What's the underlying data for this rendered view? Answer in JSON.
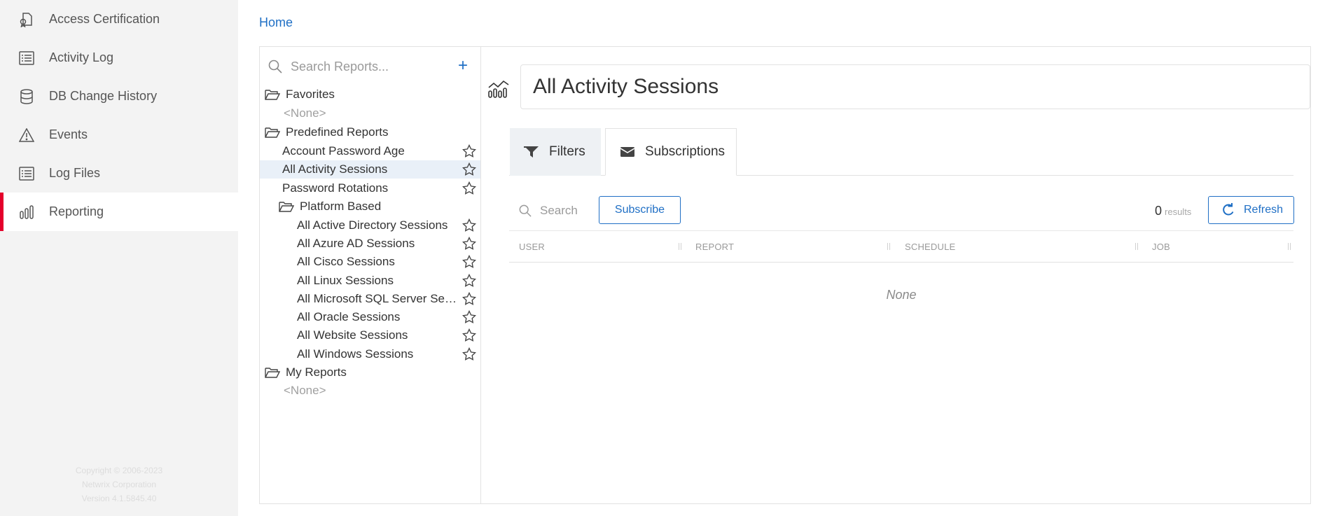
{
  "nav": {
    "items": [
      {
        "label": "Access Certification",
        "icon": "certificate-icon",
        "active": false
      },
      {
        "label": "Activity Log",
        "icon": "list-icon",
        "active": false
      },
      {
        "label": "DB Change History",
        "icon": "database-icon",
        "active": false
      },
      {
        "label": "Events",
        "icon": "warning-icon",
        "active": false
      },
      {
        "label": "Log Files",
        "icon": "list-icon",
        "active": false
      },
      {
        "label": "Reporting",
        "icon": "bar-chart-icon",
        "active": true
      }
    ],
    "accent_color": "#e4002b",
    "copyright_lines": [
      "Copyright © 2006-2023",
      "Netwrix Corporation",
      "Version 4.1.5845.40"
    ]
  },
  "breadcrumb": {
    "home": "Home"
  },
  "tree": {
    "search_placeholder": "Search Reports...",
    "add_label": "+",
    "favorites": {
      "label": "Favorites",
      "empty": "<None>"
    },
    "predefined": {
      "label": "Predefined Reports",
      "items": [
        "Account Password Age",
        "All Activity Sessions",
        "Password Rotations"
      ],
      "selected": "All Activity Sessions"
    },
    "platform": {
      "label": "Platform Based",
      "items": [
        "All Active Directory Sessions",
        "All Azure AD Sessions",
        "All Cisco Sessions",
        "All Linux Sessions",
        "All Microsoft SQL Server Ses...",
        "All Oracle Sessions",
        "All Website Sessions",
        "All Windows Sessions"
      ]
    },
    "my_reports": {
      "label": "My Reports",
      "empty": "<None>"
    }
  },
  "report": {
    "title": "All Activity Sessions",
    "tabs": [
      {
        "label": "Filters",
        "icon": "filter-icon"
      },
      {
        "label": "Subscriptions",
        "icon": "envelope-icon",
        "active": true
      }
    ],
    "subscriptions": {
      "search_placeholder": "Search",
      "subscribe_label": "Subscribe",
      "results_count": "0",
      "results_label": "results",
      "refresh_label": "Refresh",
      "columns": [
        "USER",
        "REPORT",
        "SCHEDULE",
        "JOB"
      ],
      "empty_text": "None"
    }
  },
  "colors": {
    "link": "#1f6fc5",
    "selected_row": "#e9f0f8"
  }
}
